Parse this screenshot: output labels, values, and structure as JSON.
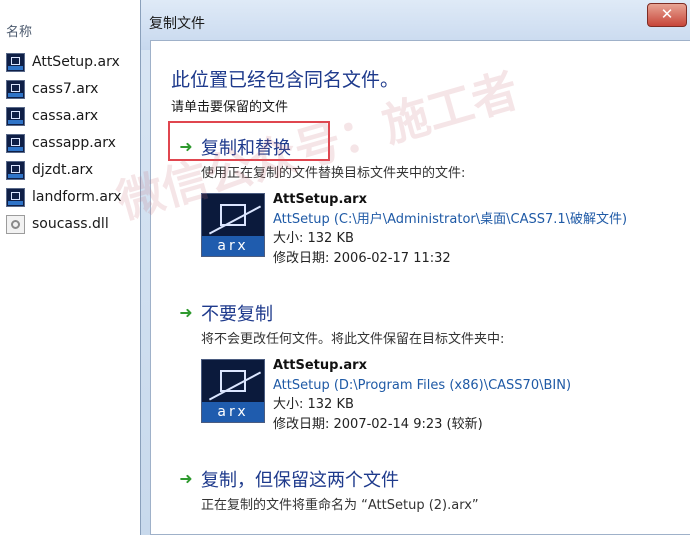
{
  "explorer": {
    "column_header": "名称",
    "files": [
      {
        "name": "AttSetup.arx",
        "icon": "arx-file-icon"
      },
      {
        "name": "cass7.arx",
        "icon": "arx-file-icon"
      },
      {
        "name": "cassa.arx",
        "icon": "arx-file-icon"
      },
      {
        "name": "cassapp.arx",
        "icon": "arx-file-icon"
      },
      {
        "name": "djzdt.arx",
        "icon": "arx-file-icon"
      },
      {
        "name": "landform.arx",
        "icon": "arx-file-icon"
      },
      {
        "name": "soucass.dll",
        "icon": "dll-file-icon"
      }
    ]
  },
  "dialog": {
    "title": "复制文件",
    "close_label": "✕",
    "heading": "此位置已经包含同名文件。",
    "subheading": "请单击要保留的文件",
    "options": [
      {
        "title": "复制和替换",
        "description": "使用正在复制的文件替换目标文件夹中的文件:",
        "file": {
          "name": "AttSetup.arx",
          "path": "AttSetup (C:\\用户\\Administrator\\桌面\\CASS7.1\\破解文件)",
          "size": "大小: 132 KB",
          "modified": "修改日期: 2006-02-17 11:32"
        }
      },
      {
        "title": "不要复制",
        "description": "将不会更改任何文件。将此文件保留在目标文件夹中:",
        "file": {
          "name": "AttSetup.arx",
          "path": "AttSetup (D:\\Program Files (x86)\\CASS70\\BIN)",
          "size": "大小: 132 KB",
          "modified": "修改日期: 2007-02-14 9:23 (较新)"
        }
      },
      {
        "title": "复制，但保留这两个文件",
        "description": "正在复制的文件将重命名为 “AttSetup (2).arx”"
      }
    ],
    "icon_label": "arx"
  },
  "watermark": "微信公众号：施工者",
  "colors": {
    "link_blue": "#1e3a8c",
    "path_blue": "#1f5aa6",
    "arrow_green": "#2f9a2f",
    "highlight_red": "#e0464f",
    "close_red": "#c7463a"
  }
}
